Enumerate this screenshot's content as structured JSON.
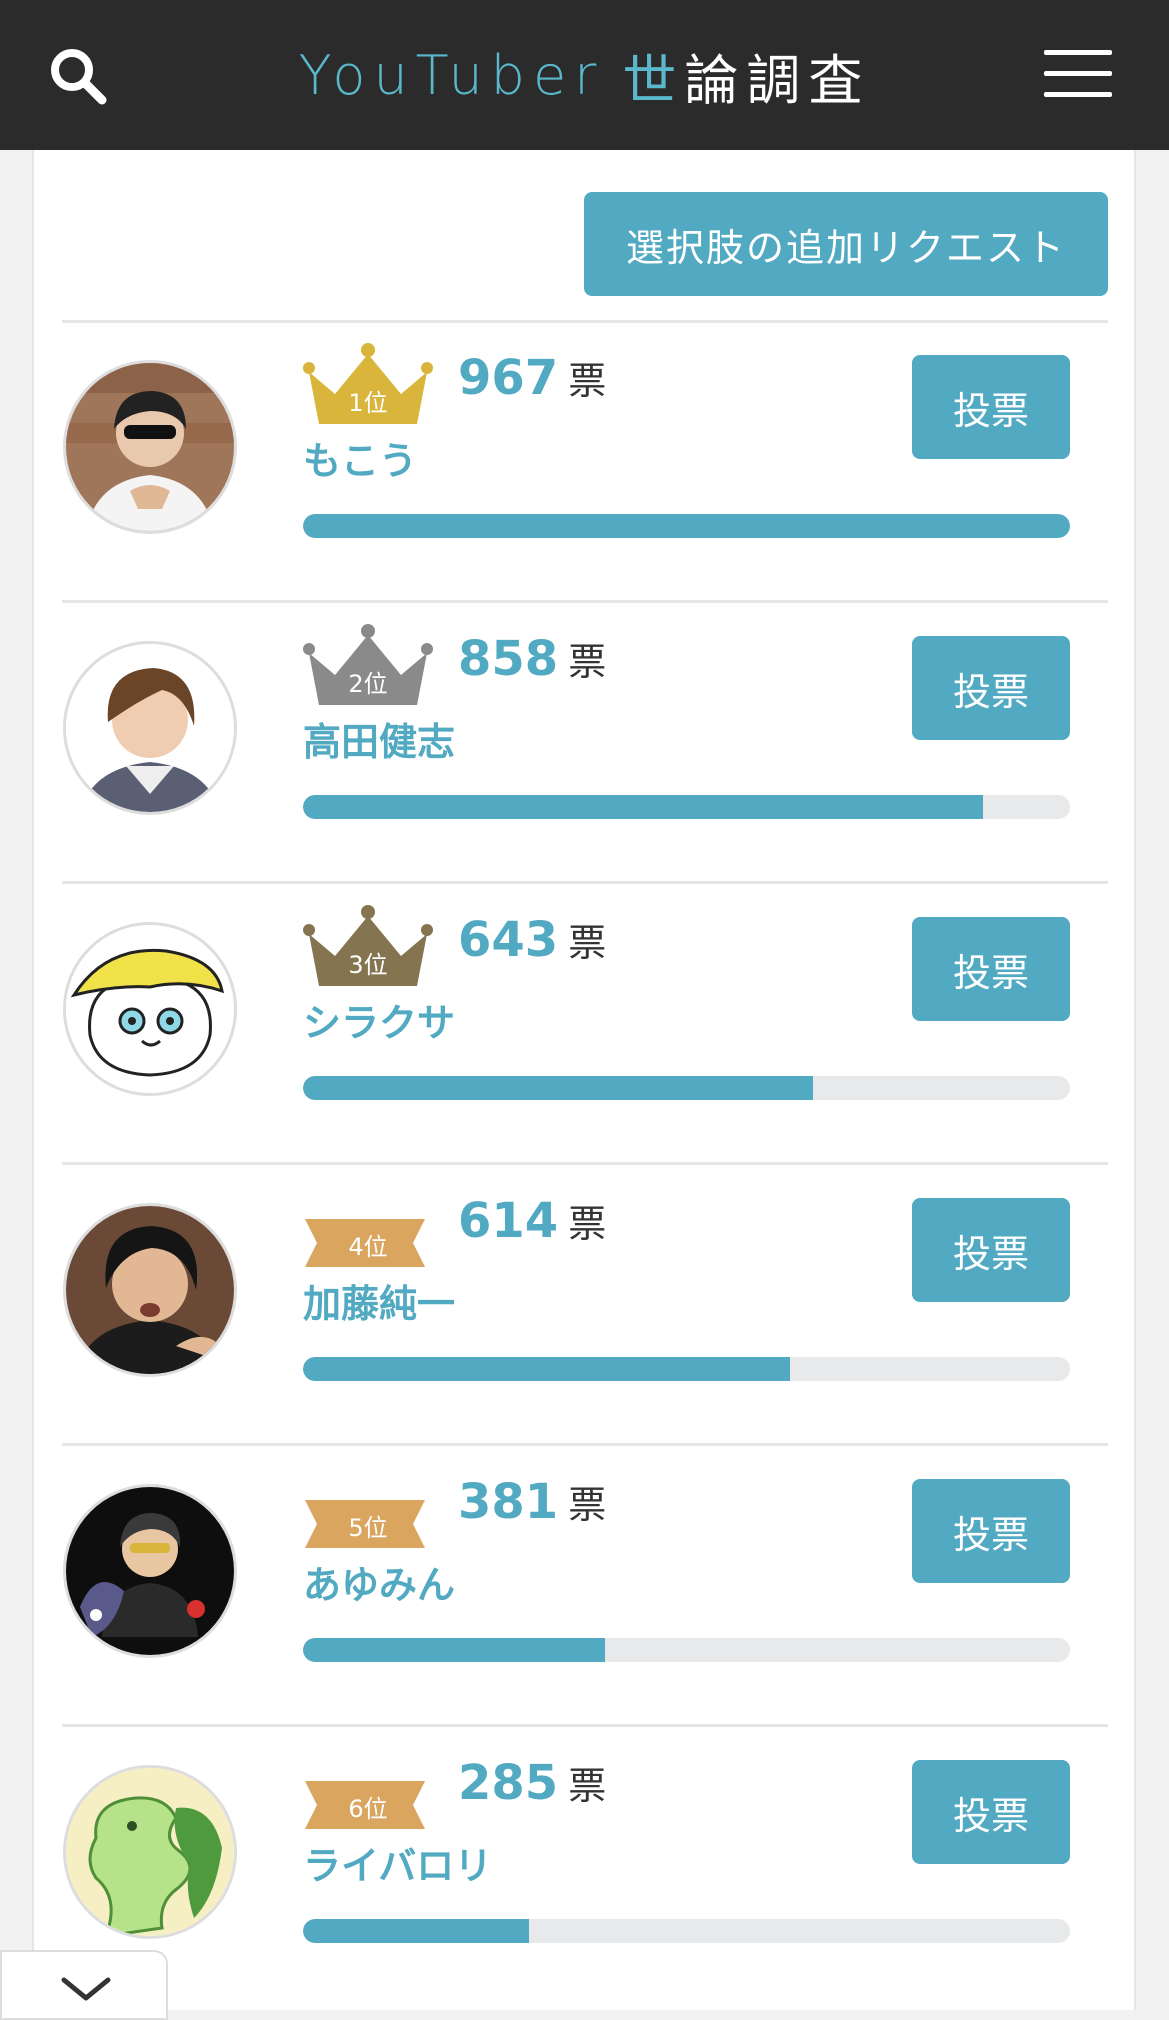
{
  "header": {
    "logo_latin": "YouTuber",
    "logo_kanji_accent": "世",
    "logo_kanji_rest": "論調査",
    "search_icon": "search-icon",
    "menu_icon": "hamburger-menu-icon"
  },
  "request_button": {
    "label": "選択肢の追加リクエスト"
  },
  "vote_unit": "票",
  "vote_button_label": "投票",
  "accent_color": "#52a9c2",
  "header_bg": "#2b2b2b",
  "candidates": [
    {
      "rank_label": "1位",
      "rank_style": "gold-crown",
      "votes": "967",
      "name": "もこう",
      "share": 1.0
    },
    {
      "rank_label": "2位",
      "rank_style": "silver-crown",
      "votes": "858",
      "name": "高田健志",
      "share": 0.887
    },
    {
      "rank_label": "3位",
      "rank_style": "bronze-crown",
      "votes": "643",
      "name": "シラクサ",
      "share": 0.665
    },
    {
      "rank_label": "4位",
      "rank_style": "ribbon",
      "votes": "614",
      "name": "加藤純一",
      "share": 0.635
    },
    {
      "rank_label": "5位",
      "rank_style": "ribbon",
      "votes": "381",
      "name": "あゆみん",
      "share": 0.394
    },
    {
      "rank_label": "6位",
      "rank_style": "ribbon",
      "votes": "285",
      "name": "ライバロリ",
      "share": 0.295
    }
  ],
  "collapse_icon": "chevron-down-icon"
}
